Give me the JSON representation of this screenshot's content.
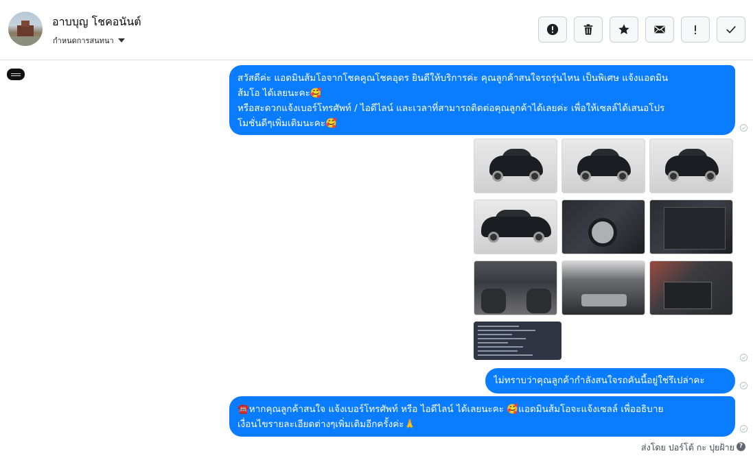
{
  "header": {
    "contact_name": "อาบบุญ โชคอนันต์",
    "conversation_label": "กำหนดการสนทนา",
    "tools": [
      {
        "icon": "alert-circle-icon"
      },
      {
        "icon": "trash-icon"
      },
      {
        "icon": "star-icon"
      },
      {
        "icon": "envelope-icon"
      },
      {
        "icon": "exclamation-icon",
        "text": "!"
      },
      {
        "icon": "check-icon"
      }
    ]
  },
  "messages": {
    "greeting_lines": [
      "สวัสดีค่ะ แอดมินส้มโอจากโชคคูณโชคอุดร ยินดีให้บริการค่ะ   คุณลูกค้าสนใจรถรุ่นไหน เป็นพิเศษ แจ้งแอดมิน",
      "ส้มโอ ได้เลยนะคะ🥰",
      "หรือสะดวกแจ้งเบอร์โทรศัพท์ / ไอดีไลน์ และเวลาที่สามารถติดต่อคุณลูกค้าได้เลยค่ะ เพื่อให้เซลล์ได้เสนอโปร",
      "โมชั่นดีๆเพิ่มเติมนะคะ🥰"
    ],
    "ask_text": "ไม่ทราบว่าคุณลูกค้ากำลังสนใจรถคันนี้อยู่ใช่รึเปล่าคะ",
    "call_lines": [
      "☎️หากคุณลูกค้าสนใจ แจ้งเบอร์โทรศัพท์ หรือ ไอดีไลน์  ได้เลยนะคะ 🥰แอดมินส้มโอจะแจ้งเซลล์   เพื่ออธิบาย",
      "เงื่อนไขรายละเอียดต่างๆเพิ่มเติมอีกครั้งค่ะ🙏"
    ]
  },
  "photos": [
    {
      "kind": "car-front"
    },
    {
      "kind": "car-rear-left"
    },
    {
      "kind": "car-rear"
    },
    {
      "kind": "car-side"
    },
    {
      "kind": "wheel"
    },
    {
      "kind": "door-panel"
    },
    {
      "kind": "interior"
    },
    {
      "kind": "engine"
    },
    {
      "kind": "battery"
    },
    {
      "kind": "document"
    }
  ],
  "footer": {
    "sent_by": "ส่งโดย ปอร์โต้ กะ ปุยฝ้าย",
    "help_text": "?"
  },
  "colors": {
    "bubble": "#0a7cff",
    "border": "#dadde1"
  }
}
